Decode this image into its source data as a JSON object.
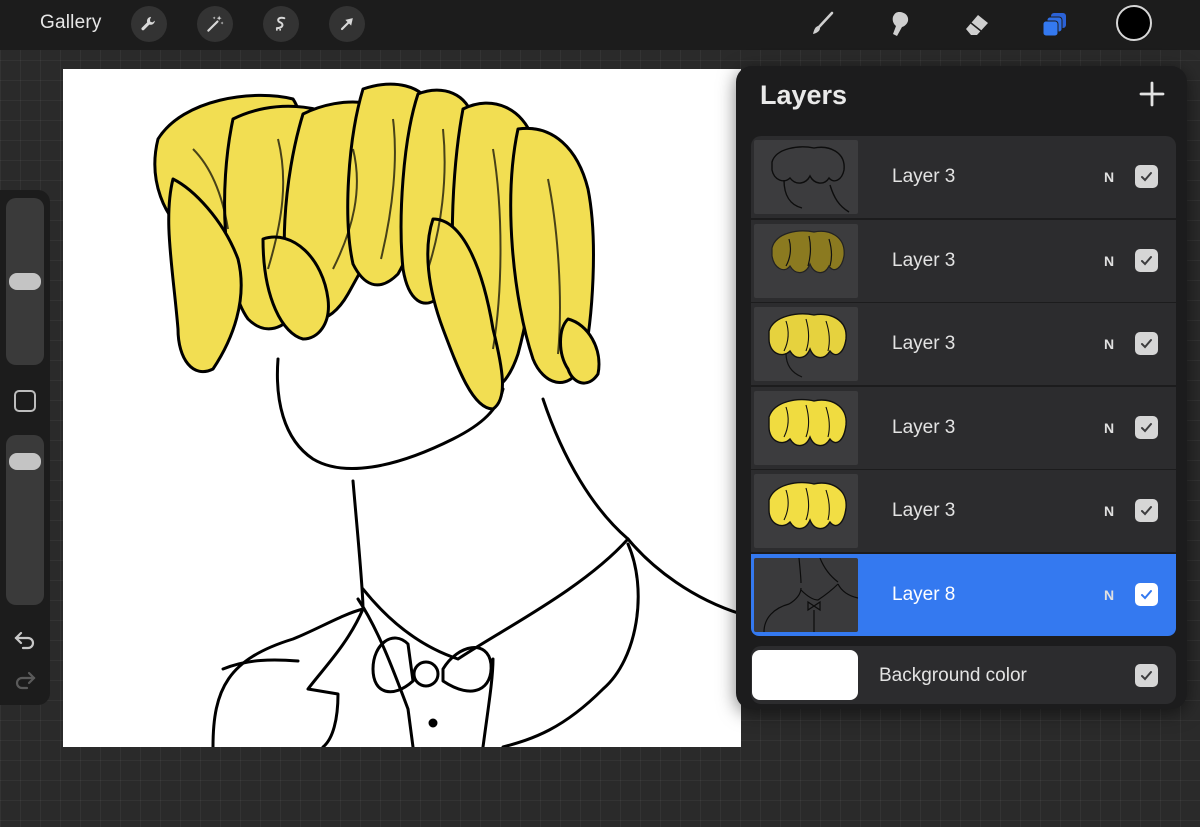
{
  "toolbar": {
    "gallery_label": "Gallery",
    "left_tools": [
      "wrench-icon",
      "magic-wand-icon",
      "selection-icon",
      "transform-arrow-icon"
    ],
    "right_tools": [
      "brush-icon",
      "smudge-icon",
      "eraser-icon",
      "layers-icon"
    ],
    "active_tool": "layers-icon",
    "accent_color": "#3479f0",
    "current_color": "#000000"
  },
  "sidebar": {
    "brush_size_level": 0.5,
    "opacity_level": 0.9,
    "icons": [
      "modify-square-icon",
      "undo-icon",
      "redo-icon"
    ]
  },
  "layers_panel": {
    "title": "Layers",
    "add_icon": "plus-icon",
    "layers": [
      {
        "name": "Layer 3",
        "blend": "N",
        "visible": true,
        "selected": false
      },
      {
        "name": "Layer 3",
        "blend": "N",
        "visible": true,
        "selected": false
      },
      {
        "name": "Layer 3",
        "blend": "N",
        "visible": true,
        "selected": false
      },
      {
        "name": "Layer 3",
        "blend": "N",
        "visible": true,
        "selected": false
      },
      {
        "name": "Layer 3",
        "blend": "N",
        "visible": true,
        "selected": false
      },
      {
        "name": "Layer 8",
        "blend": "N",
        "visible": true,
        "selected": true
      }
    ],
    "background": {
      "label": "Background color",
      "color": "#ffffff",
      "visible": true
    }
  },
  "canvas": {
    "hair_color": "#f2de52",
    "line_color": "#000000",
    "paper_color": "#ffffff"
  }
}
